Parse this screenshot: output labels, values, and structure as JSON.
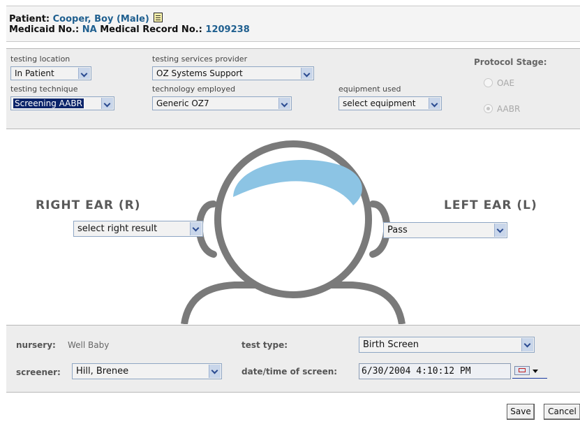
{
  "patient": {
    "name_label": "Patient:",
    "name": "Cooper, Boy (Male)",
    "notes_icon": "notes-icon",
    "medicaid_label": "Medicaid No.:",
    "medicaid_no": "NA",
    "mrn_label": "Medical Record No.:",
    "mrn": "1209238"
  },
  "settings": {
    "testing_location": {
      "label": "testing location",
      "value": "In Patient"
    },
    "testing_services_provider": {
      "label": "testing services provider",
      "value": "OZ Systems Support"
    },
    "testing_technique": {
      "label": "testing technique",
      "value": "Screening AABR"
    },
    "technology_employed": {
      "label": "technology employed",
      "value": "Generic OZ7"
    },
    "equipment_used": {
      "label": "equipment used",
      "value": "select equipment"
    },
    "protocol_stage": {
      "title": "Protocol Stage:",
      "options": [
        {
          "label": "OAE",
          "selected": false
        },
        {
          "label": "AABR",
          "selected": true
        }
      ]
    }
  },
  "ears": {
    "right": {
      "title": "RIGHT EAR (R)",
      "value": "select right result"
    },
    "left": {
      "title": "LEFT EAR (L)",
      "value": "Pass"
    }
  },
  "screening": {
    "nursery_label": "nursery:",
    "nursery_value": "Well Baby",
    "screener_label": "screener:",
    "screener_value": "Hill, Brenee",
    "test_type_label": "test type:",
    "test_type_value": "Birth Screen",
    "datetime_label": "date/time of screen:",
    "datetime_value": "6/30/2004 4:10:12 PM",
    "calendar_icon": "calendar-icon"
  },
  "actions": {
    "save": "Save",
    "cancel": "Cancel"
  },
  "colors": {
    "accent": "#1f5f8f",
    "hair": "#8cc4e4",
    "head_outline": "#7a7a7a"
  }
}
